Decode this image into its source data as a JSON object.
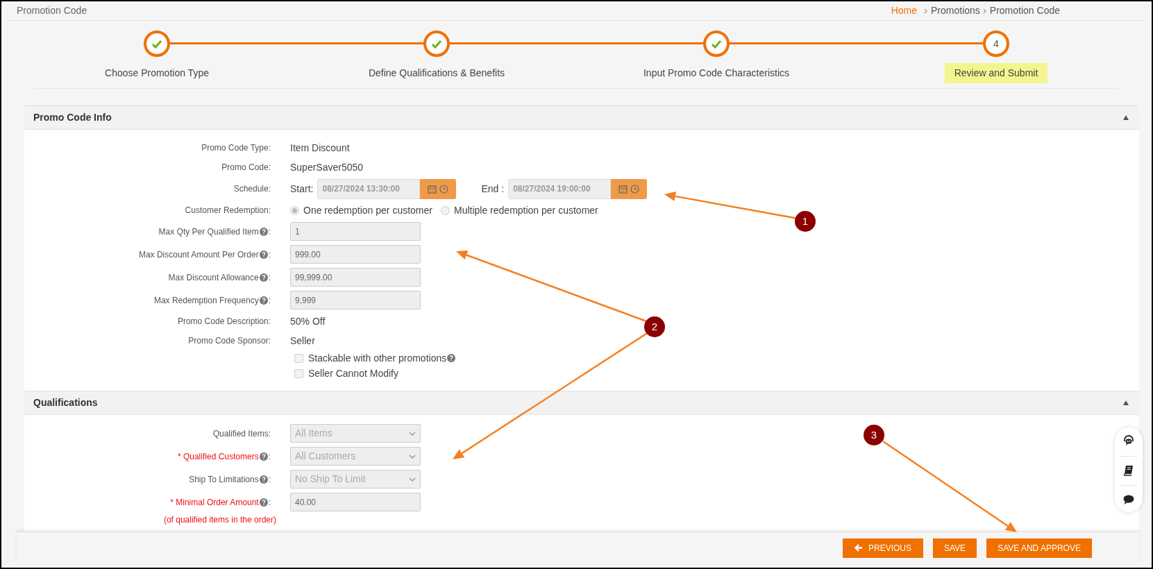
{
  "header": {
    "title": "Promotion Code",
    "breadcrumb": [
      {
        "label": "Home",
        "link": true
      },
      {
        "label": "Promotions",
        "link": false
      },
      {
        "label": "Promotion Code",
        "link": false
      }
    ]
  },
  "steps": [
    {
      "label": "Choose Promotion Type",
      "done": true,
      "selected": false
    },
    {
      "label": "Define Qualifications & Benefits",
      "done": true,
      "selected": false
    },
    {
      "label": "Input Promo Code Characteristics",
      "done": true,
      "selected": false
    },
    {
      "label": "Review and Submit",
      "number": "4",
      "done": false,
      "selected": true
    }
  ],
  "sections": [
    {
      "title": "Promo Code Info",
      "expanded": true,
      "rows": [
        {
          "kind": "text",
          "label": "Promo Code Type:",
          "value": "Item Discount"
        },
        {
          "kind": "text",
          "label": "Promo Code:",
          "value": "SuperSaver5050"
        },
        {
          "kind": "schedule",
          "label": "Schedule:",
          "start_label": "Start:",
          "start": "08/27/2024 13:30:00",
          "end_label": "End :",
          "end": "08/27/2024 19:00:00"
        },
        {
          "kind": "radio",
          "label": "Customer Redemption:",
          "options": [
            {
              "label": "One redemption per customer",
              "selected": true
            },
            {
              "label": "Multiple redemption per customer",
              "selected": false
            }
          ]
        },
        {
          "kind": "input",
          "label": "Max Qty Per Qualified Item",
          "help": true,
          "colon": ":",
          "value": "1"
        },
        {
          "kind": "input",
          "label": "Max Discount Amount Per Order",
          "help": true,
          "colon": ":",
          "value": "999.00"
        },
        {
          "kind": "input",
          "label": "Max Discount Allowance",
          "help": true,
          "colon": ":",
          "value": "99,999.00"
        },
        {
          "kind": "input",
          "label": "Max Redemption Frequency",
          "help": true,
          "colon": ":",
          "value": "9,999"
        },
        {
          "kind": "text",
          "label": "Promo Code Description:",
          "value": "50% Off"
        },
        {
          "kind": "text",
          "label": "Promo Code Sponsor:",
          "value": "Seller"
        },
        {
          "kind": "checkbox",
          "label": "Stackable with other promotions",
          "help": true,
          "checked": false
        },
        {
          "kind": "checkbox",
          "label": "Seller Cannot Modify",
          "checked": false
        }
      ]
    },
    {
      "title": "Qualifications",
      "expanded": true,
      "rows": [
        {
          "kind": "select",
          "label": "Qualified Items:",
          "required": false,
          "value": "All Items"
        },
        {
          "kind": "select",
          "label": "* Qualified Customers",
          "required": true,
          "help": true,
          "colon": ":",
          "value": "All Customers"
        },
        {
          "kind": "select",
          "label": "Ship To Limitations",
          "required": false,
          "help": true,
          "colon": ":",
          "value": "No Ship To Limit"
        },
        {
          "kind": "input",
          "label": "* Minimal Order Amount",
          "required": true,
          "help": true,
          "colon": ":",
          "value": "40.00",
          "note": "(of qualified items in the order)"
        }
      ]
    }
  ],
  "buttons": [
    {
      "label": "PREVIOUS",
      "kind": "back"
    },
    {
      "label": "SAVE",
      "kind": "plain"
    },
    {
      "label": "SAVE AND APPROVE",
      "kind": "plain"
    }
  ],
  "callouts": [
    {
      "number": "1"
    },
    {
      "number": "2"
    },
    {
      "number": "3"
    }
  ]
}
